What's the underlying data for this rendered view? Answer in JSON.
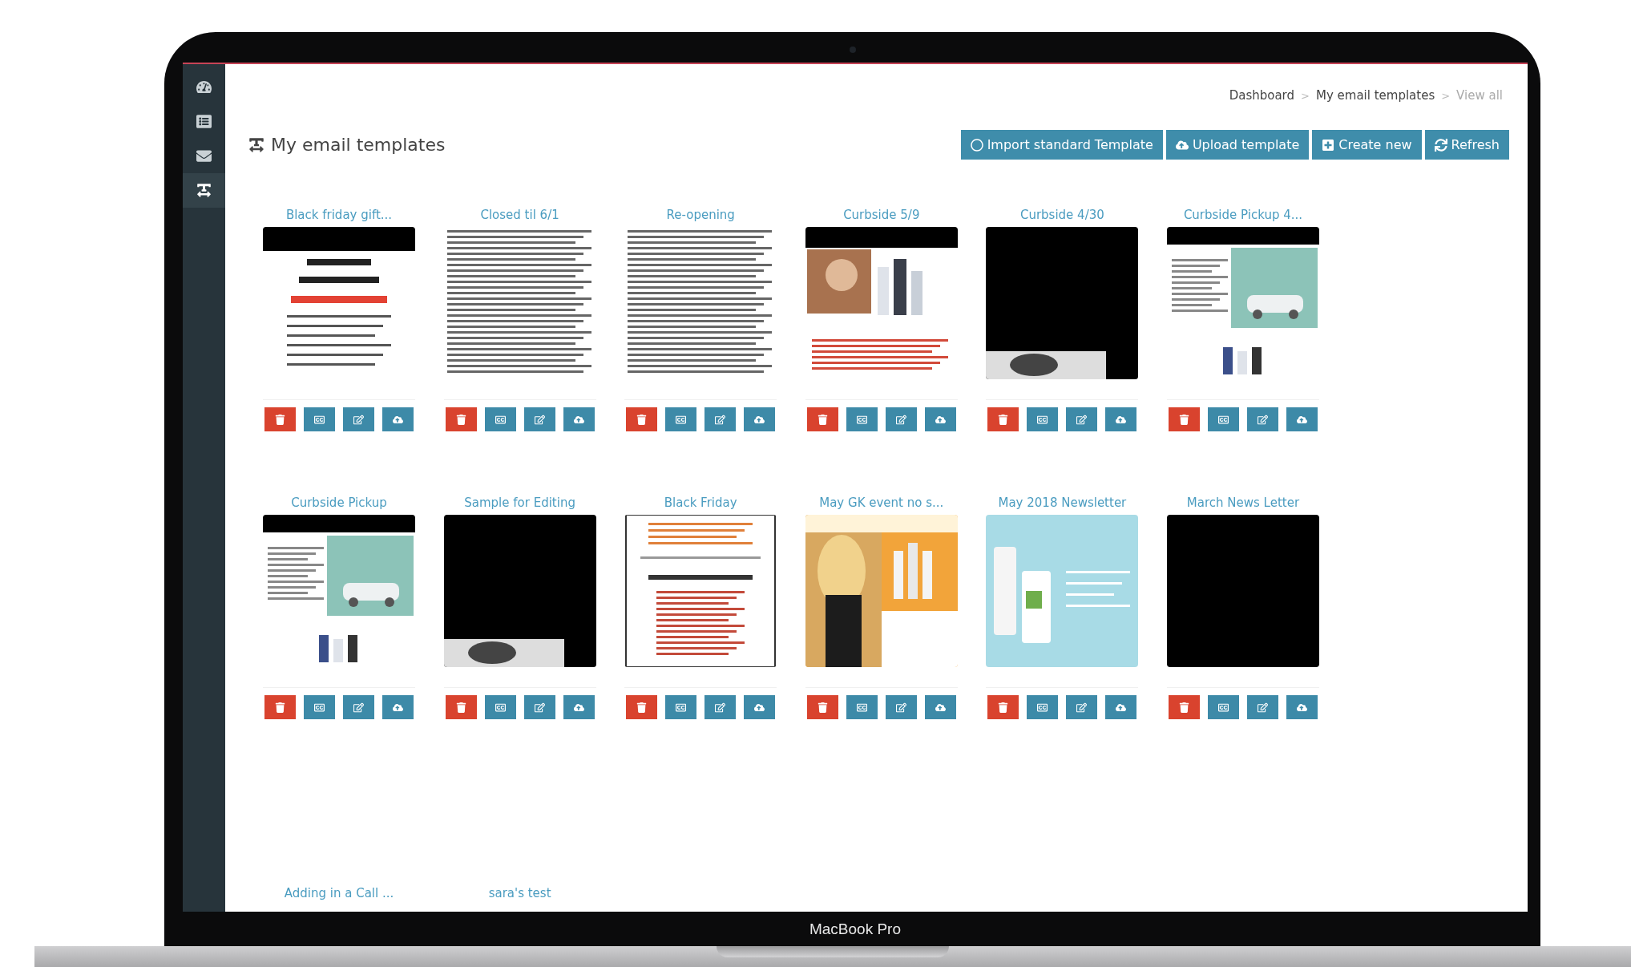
{
  "sidebar": {
    "items": [
      {
        "kind": "dashboard",
        "selected": false
      },
      {
        "kind": "list",
        "selected": false
      },
      {
        "kind": "mail",
        "selected": false
      },
      {
        "kind": "templates",
        "selected": true
      }
    ]
  },
  "breadcrumb": [
    {
      "label": "Dashboard",
      "current": false
    },
    {
      "separator": ">",
      "label": "My email templates",
      "current": false
    },
    {
      "separator": ">",
      "label": "View all",
      "current": true
    }
  ],
  "page_title": "My email templates",
  "toolbar": [
    {
      "kind": "import",
      "label": "Import standard Template"
    },
    {
      "kind": "upload",
      "label": "Upload template"
    },
    {
      "kind": "create",
      "label": "Create new"
    },
    {
      "kind": "refresh",
      "label": "Refresh"
    }
  ],
  "templates": [
    {
      "title": "Black friday gift...",
      "actions": [
        {
          "kind": "delete"
        },
        {
          "kind": "preview"
        },
        {
          "kind": "edit"
        },
        {
          "kind": "upload"
        }
      ]
    },
    {
      "title": "Closed til 6/1",
      "actions": [
        {
          "kind": "delete"
        },
        {
          "kind": "preview"
        },
        {
          "kind": "edit"
        },
        {
          "kind": "upload"
        }
      ]
    },
    {
      "title": "Re-opening",
      "actions": [
        {
          "kind": "delete"
        },
        {
          "kind": "preview"
        },
        {
          "kind": "edit"
        },
        {
          "kind": "upload"
        }
      ]
    },
    {
      "title": "Curbside 5/9",
      "actions": [
        {
          "kind": "delete"
        },
        {
          "kind": "preview"
        },
        {
          "kind": "edit"
        },
        {
          "kind": "upload"
        }
      ]
    },
    {
      "title": "Curbside 4/30",
      "actions": [
        {
          "kind": "delete"
        },
        {
          "kind": "preview"
        },
        {
          "kind": "edit"
        },
        {
          "kind": "upload"
        }
      ]
    },
    {
      "title": "Curbside Pickup 4...",
      "actions": [
        {
          "kind": "delete"
        },
        {
          "kind": "preview"
        },
        {
          "kind": "edit"
        },
        {
          "kind": "upload"
        }
      ]
    },
    {
      "title": "Curbside Pickup",
      "actions": [
        {
          "kind": "delete"
        },
        {
          "kind": "preview"
        },
        {
          "kind": "edit"
        },
        {
          "kind": "upload"
        }
      ]
    },
    {
      "title": "Sample for Editing",
      "actions": [
        {
          "kind": "delete"
        },
        {
          "kind": "preview"
        },
        {
          "kind": "edit"
        },
        {
          "kind": "upload"
        }
      ]
    },
    {
      "title": "Black Friday",
      "actions": [
        {
          "kind": "delete"
        },
        {
          "kind": "preview"
        },
        {
          "kind": "edit"
        },
        {
          "kind": "upload"
        }
      ]
    },
    {
      "title": "May GK event no s...",
      "actions": [
        {
          "kind": "delete"
        },
        {
          "kind": "preview"
        },
        {
          "kind": "edit"
        },
        {
          "kind": "upload"
        }
      ]
    },
    {
      "title": "May 2018 Newsletter",
      "actions": [
        {
          "kind": "delete"
        },
        {
          "kind": "preview"
        },
        {
          "kind": "edit"
        },
        {
          "kind": "upload"
        }
      ]
    },
    {
      "title": "March News Letter",
      "actions": [
        {
          "kind": "delete"
        },
        {
          "kind": "preview"
        },
        {
          "kind": "edit"
        },
        {
          "kind": "upload"
        }
      ]
    },
    {
      "title": "Adding in a Call ..."
    },
    {
      "title": "sara's test"
    }
  ],
  "device_label": "MacBook Pro"
}
